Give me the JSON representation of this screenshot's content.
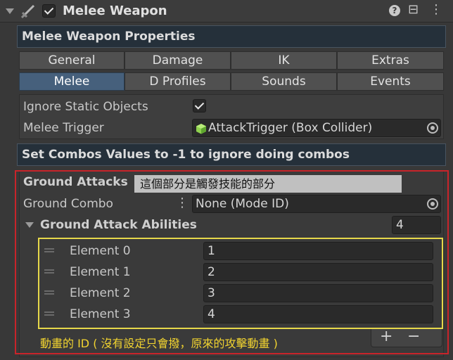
{
  "header": {
    "title": "Melee Weapon",
    "help_glyph": "?",
    "settings_glyph": "⊟",
    "more_glyph": "⋮"
  },
  "props_bar": "Melee Weapon Properties",
  "tabs_row1": [
    "General",
    "Damage",
    "IK",
    "Extras"
  ],
  "tabs_row2": [
    "Melee",
    "D Profiles",
    "Sounds",
    "Events"
  ],
  "active_tab": "Melee",
  "fields": {
    "ignore_static_label": "Ignore Static Objects",
    "melee_trigger_label": "Melee Trigger",
    "melee_trigger_value": "AttackTrigger (Box Collider)"
  },
  "combos_bar": "Set Combos Values to -1 to ignore doing combos",
  "ground": {
    "title": "Ground Attacks",
    "annotation": "這個部分是觸發技能的部分",
    "combo_label": "Ground Combo",
    "combo_value": "None (Mode ID)",
    "abilities_label": "Ground Attack Abilities",
    "abilities_count": "4",
    "elements": [
      {
        "label": "Element 0",
        "value": "1"
      },
      {
        "label": "Element 1",
        "value": "2"
      },
      {
        "label": "Element 2",
        "value": "3"
      },
      {
        "label": "Element 3",
        "value": "4"
      }
    ],
    "add_glyph": "+",
    "remove_glyph": "−",
    "note": "動畫的 ID ( 沒有設定只會撥，原來的攻擊動畫 )"
  },
  "colors": {
    "highlight_red": "#c8242a",
    "highlight_yellow": "#e6d84a",
    "note_text": "#f2d430",
    "active_tab": "#46607c"
  }
}
